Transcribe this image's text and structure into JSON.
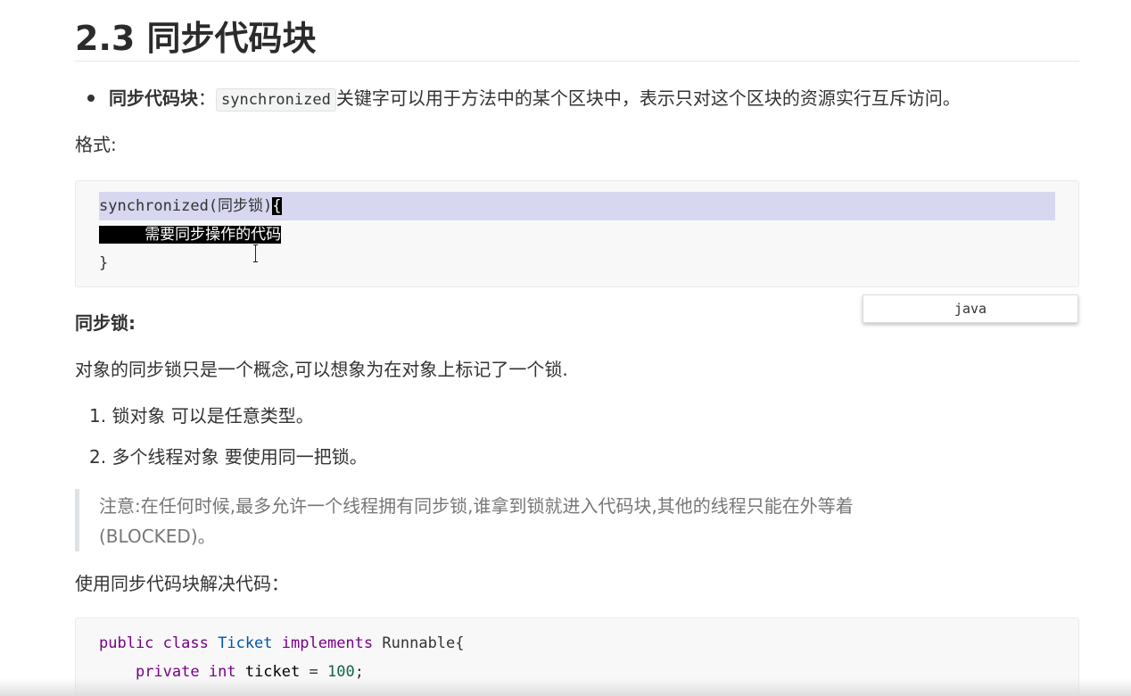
{
  "heading": "2.3 同步代码块",
  "bullet": {
    "label": "同步代码块",
    "sep": "：",
    "code": "synchronized",
    "text": "关键字可以用于方法中的某个区块中，表示只对这个区块的资源实行互斥访问。"
  },
  "format_label": "格式:",
  "code_block_1": {
    "line1_code": "synchronized(同步锁)",
    "line1_brace": "{",
    "line2_indent": "     ",
    "line2_text": "需要同步操作的代码",
    "line3": "}"
  },
  "language_selector": "java",
  "lock_heading": "同步锁:",
  "lock_description": "对象的同步锁只是一个概念,可以想象为在对象上标记了一个锁.",
  "list_items": [
    {
      "num": "1.",
      "text": "锁对象 可以是任意类型。"
    },
    {
      "num": "2.",
      "text": "多个线程对象  要使用同一把锁。"
    }
  ],
  "note": {
    "line1": "注意:在任何时候,最多允许一个线程拥有同步锁,谁拿到锁就进入代码块,其他的线程只能在外等着",
    "line2": "(BLOCKED)。"
  },
  "solution_label": "使用同步代码块解决代码：",
  "code_block_2": {
    "l1_kw1": "public",
    "l1_kw2": "class",
    "l1_type": "Ticket",
    "l1_kw3": "implements",
    "l1_iface": "Runnable{",
    "l2_kw": "private",
    "l2_type": "int",
    "l2_var": "ticket",
    "l2_op": "=",
    "l2_num": "100",
    "l2_end": ";"
  }
}
